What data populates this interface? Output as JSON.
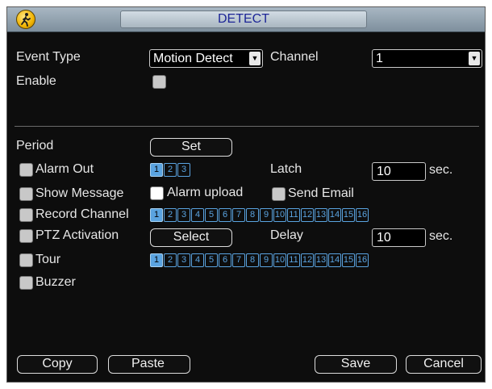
{
  "window": {
    "title": "DETECT"
  },
  "event_type": {
    "label": "Event Type",
    "value": "Motion Detect"
  },
  "channel": {
    "label": "Channel",
    "value": "1"
  },
  "enable": {
    "label": "Enable"
  },
  "period": {
    "label": "Period",
    "button": "Set"
  },
  "alarm_out": {
    "label": "Alarm Out",
    "outputs": [
      "1",
      "2",
      "3"
    ],
    "active": [
      "1"
    ]
  },
  "latch": {
    "label": "Latch",
    "value": "10",
    "unit": "sec."
  },
  "show_message": {
    "label": "Show Message"
  },
  "alarm_upload": {
    "label": "Alarm upload"
  },
  "send_email": {
    "label": "Send Email"
  },
  "record_channel": {
    "label": "Record Channel",
    "channels": [
      "1",
      "2",
      "3",
      "4",
      "5",
      "6",
      "7",
      "8",
      "9",
      "10",
      "11",
      "12",
      "13",
      "14",
      "15",
      "16"
    ],
    "active": [
      "1"
    ]
  },
  "ptz_activation": {
    "label": "PTZ Activation",
    "button": "Select"
  },
  "delay": {
    "label": "Delay",
    "value": "10",
    "unit": "sec."
  },
  "tour": {
    "label": "Tour",
    "channels": [
      "1",
      "2",
      "3",
      "4",
      "5",
      "6",
      "7",
      "8",
      "9",
      "10",
      "11",
      "12",
      "13",
      "14",
      "15",
      "16"
    ],
    "active": [
      "1"
    ]
  },
  "buzzer": {
    "label": "Buzzer"
  },
  "buttons": {
    "copy": "Copy",
    "paste": "Paste",
    "save": "Save",
    "cancel": "Cancel"
  },
  "colors": {
    "accent": "#5aa3e0",
    "title_text": "#1c2596",
    "background": "#0d0d0d"
  },
  "icons": {
    "logo": "walking-person-icon",
    "dropdown": "chevron-down-icon"
  }
}
